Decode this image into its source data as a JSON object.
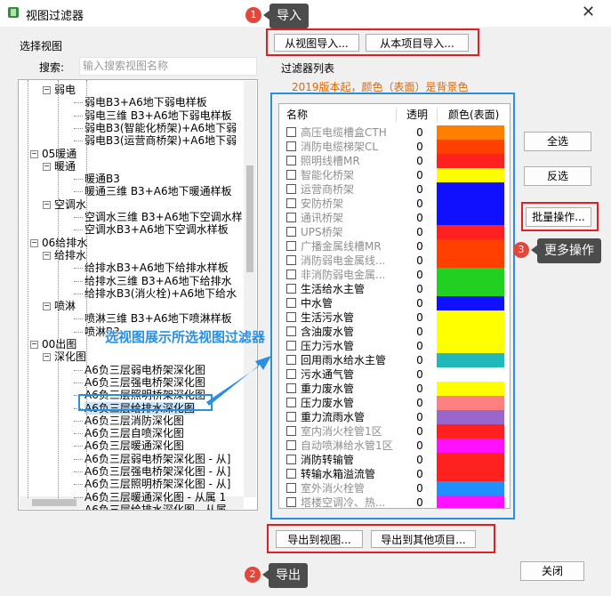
{
  "window": {
    "title": "视图过滤器",
    "close_glyph": "✕"
  },
  "left": {
    "section_label": "选择视图",
    "search_label": "搜索:",
    "search_placeholder": "输入搜索视图名称",
    "tree": [
      {
        "label": "弱电",
        "level": 2,
        "toggle": "−"
      },
      {
        "label": "弱电B3+A6地下弱电样板",
        "level": 3
      },
      {
        "label": "弱电三维 B3+A6地下弱电样板",
        "level": 3
      },
      {
        "label": "弱电B3(智能化桥架)+A6地下弱",
        "level": 3
      },
      {
        "label": "弱电B3(运营商桥架)+A6地下弱",
        "level": 3
      },
      {
        "label": "05暖通",
        "level": 1,
        "toggle": "−"
      },
      {
        "label": "暖通",
        "level": 2,
        "toggle": "−"
      },
      {
        "label": "暖通B3",
        "level": 3
      },
      {
        "label": "暖通三维 B3+A6地下暖通样板",
        "level": 3
      },
      {
        "label": "空调水",
        "level": 2,
        "toggle": "−"
      },
      {
        "label": "空调水三维 B3+A6地下空调水样",
        "level": 3
      },
      {
        "label": "空调水B3+A6地下空调水样板",
        "level": 3
      },
      {
        "label": "06给排水",
        "level": 1,
        "toggle": "−"
      },
      {
        "label": "给排水",
        "level": 2,
        "toggle": "−"
      },
      {
        "label": "给排水B3+A6地下给排水样板",
        "level": 3
      },
      {
        "label": "给排水三维 B3+A6地下给排水",
        "level": 3
      },
      {
        "label": "给排水B3(消火栓)+A6地下给水",
        "level": 3
      },
      {
        "label": "喷淋",
        "level": 2,
        "toggle": "−"
      },
      {
        "label": "喷淋三维 B3+A6地下喷淋样板",
        "level": 3
      },
      {
        "label": "喷淋B3",
        "level": 3
      },
      {
        "label": "00出图",
        "level": 1,
        "toggle": "−"
      },
      {
        "label": "深化图",
        "level": 2,
        "toggle": "−"
      },
      {
        "label": "A6负三层弱电桥架深化图",
        "level": 3
      },
      {
        "label": "A6负三层强电桥架深化图",
        "level": 3
      },
      {
        "label": "A6负三层照明桥架深化图",
        "level": 3
      },
      {
        "label": "A6负三层给排水深化图",
        "level": 3,
        "selected": true
      },
      {
        "label": "A6负三层消防深化图",
        "level": 3
      },
      {
        "label": "A6负三层自喷深化图",
        "level": 3
      },
      {
        "label": "A6负三层暖通深化图",
        "level": 3
      },
      {
        "label": "A6负三层弱电桥架深化图 - 从]",
        "level": 3
      },
      {
        "label": "A6负三层强电桥架深化图 - 从]",
        "level": 3
      },
      {
        "label": "A6负三层照明桥架深化图 - 从]",
        "level": 3
      },
      {
        "label": "A6负三层暖通深化图 - 从属 1",
        "level": 3
      },
      {
        "label": "A6负三层给排水深化图 - 从属",
        "level": 3
      }
    ]
  },
  "import": {
    "from_view": "从视图导入...",
    "from_project": "从本项目导入..."
  },
  "filter_list": {
    "title": "过滤器列表",
    "note": "2019版本起，颜色（表面）是背景色",
    "headers": {
      "name": "名称",
      "transparency": "透明",
      "color": "颜色(表面)"
    },
    "rows": [
      {
        "name": "高压电缆槽盒CTH",
        "trans": "0",
        "color": "#ff7f00",
        "dim": true
      },
      {
        "name": "消防电缆梯架CL",
        "trans": "0",
        "color": "#ff4000",
        "dim": true
      },
      {
        "name": "照明线槽MR",
        "trans": "0",
        "color": "#ff2020",
        "dim": true
      },
      {
        "name": "智能化桥架",
        "trans": "0",
        "color": "#ffff00",
        "dim": true
      },
      {
        "name": "运营商桥架",
        "trans": "0",
        "color": "#1010ff",
        "dim": true
      },
      {
        "name": "安防桥架",
        "trans": "0",
        "color": "#1010ff",
        "dim": true
      },
      {
        "name": "通讯桥架",
        "trans": "0",
        "color": "#1010ff",
        "dim": true
      },
      {
        "name": "UPS桥架",
        "trans": "0",
        "color": "#ff2020",
        "dim": true
      },
      {
        "name": "广播金属线槽MR",
        "trans": "0",
        "color": "#ff4000",
        "dim": true
      },
      {
        "name": "消防弱电金属线...",
        "trans": "0",
        "color": "#ff4000",
        "dim": true
      },
      {
        "name": "非消防弱电金属...",
        "trans": "0",
        "color": "#22d022",
        "dim": true
      },
      {
        "name": "生活给水主管",
        "trans": "0",
        "color": "#22d022",
        "dim": false
      },
      {
        "name": "中水管",
        "trans": "0",
        "color": "#1010ff",
        "dim": false
      },
      {
        "name": "生活污水管",
        "trans": "0",
        "color": "#ffff00",
        "dim": false
      },
      {
        "name": "含油废水管",
        "trans": "0",
        "color": "#ffff00",
        "dim": false
      },
      {
        "name": "压力污水管",
        "trans": "0",
        "color": "#ffff00",
        "dim": false
      },
      {
        "name": "回用雨水给水主管",
        "trans": "0",
        "color": "#20b8b8",
        "dim": false
      },
      {
        "name": "污水通气管",
        "trans": "0",
        "color": "#ffffff",
        "dim": false
      },
      {
        "name": "重力废水管",
        "trans": "0",
        "color": "#ffff00",
        "dim": false
      },
      {
        "name": "压力废水管",
        "trans": "0",
        "color": "#ff8080",
        "dim": false
      },
      {
        "name": "重力流雨水管",
        "trans": "0",
        "color": "#9966cc",
        "dim": false
      },
      {
        "name": "室内消火栓管1区",
        "trans": "0",
        "color": "#ff2020",
        "dim": true
      },
      {
        "name": "自动喷淋给水管1区",
        "trans": "0",
        "color": "#ff10ff",
        "dim": true
      },
      {
        "name": "消防转输管",
        "trans": "0",
        "color": "#ff2020",
        "dim": false
      },
      {
        "name": "转输水箱溢流管",
        "trans": "0",
        "color": "#ff2020",
        "dim": false
      },
      {
        "name": "室外消火栓管",
        "trans": "0",
        "color": "#2090ff",
        "dim": true
      },
      {
        "name": "塔楼空调冷、热...",
        "trans": "0",
        "color": "#ff10ff",
        "dim": true
      }
    ]
  },
  "side_buttons": {
    "select_all": "全选",
    "invert": "反选",
    "batch": "批量操作..."
  },
  "export": {
    "to_view": "导出到视图...",
    "to_other": "导出到其他项目..."
  },
  "close_button": "关闭",
  "annotations": {
    "import": {
      "num": "1",
      "text": "导入"
    },
    "export": {
      "num": "2",
      "text": "导出"
    },
    "more": {
      "num": "3",
      "text": "更多操作"
    },
    "overlay": "选视图展示所选视图过滤器"
  }
}
